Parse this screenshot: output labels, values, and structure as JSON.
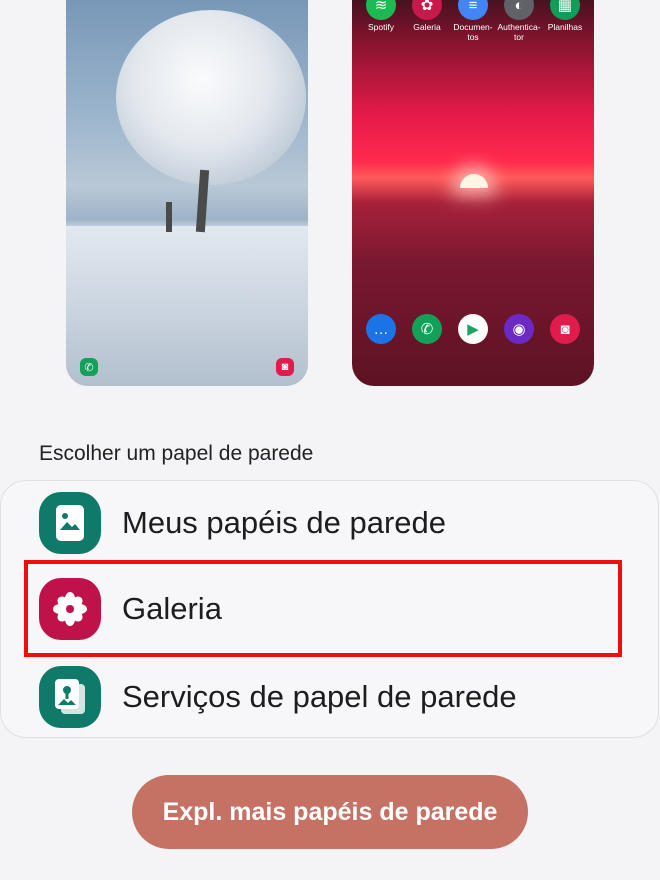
{
  "home_preview": {
    "top_apps": [
      {
        "label": "Spotify",
        "icon": "spotify-icon",
        "color": "#1db954",
        "glyph": "≋"
      },
      {
        "label": "Galeria",
        "icon": "gallery-flower-icon",
        "color": "#c7194b",
        "glyph": "✿"
      },
      {
        "label": "Documen-tos",
        "icon": "docs-icon",
        "color": "#4285f4",
        "glyph": "≡"
      },
      {
        "label": "Authentica-tor",
        "icon": "authenticator-icon",
        "color": "#5f6368",
        "glyph": "◐"
      },
      {
        "label": "Planilhas",
        "icon": "sheets-icon",
        "color": "#0f9d58",
        "glyph": "▦"
      }
    ],
    "dock_apps": [
      {
        "icon": "messages-icon",
        "color": "#1b73e8",
        "glyph": "…"
      },
      {
        "icon": "phone-icon",
        "color": "#13a15a",
        "glyph": "✆"
      },
      {
        "icon": "play-store-icon",
        "color": "#ffffff",
        "glyph": "▶"
      },
      {
        "icon": "firefox-icon",
        "color": "#6b2ac4",
        "glyph": "◉"
      },
      {
        "icon": "camera-icon",
        "color": "#e01c4c",
        "glyph": "◙"
      }
    ]
  },
  "section": {
    "title": "Escolher um papel de parede"
  },
  "options": [
    {
      "label": "Meus papéis de parede",
      "icon": "my-wallpapers-icon",
      "color": "#0f7a6a"
    },
    {
      "label": "Galeria",
      "icon": "gallery-flower-icon",
      "color": "#c0124a"
    },
    {
      "label": "Serviços de papel de parede",
      "icon": "wallpaper-services-icon",
      "color": "#0f7a6a"
    }
  ],
  "cta": {
    "label": "Expl. mais papéis de parede"
  },
  "colors": {
    "accent": "#c57265",
    "highlight": "#f20d0d",
    "background": "#f4f3f5"
  }
}
